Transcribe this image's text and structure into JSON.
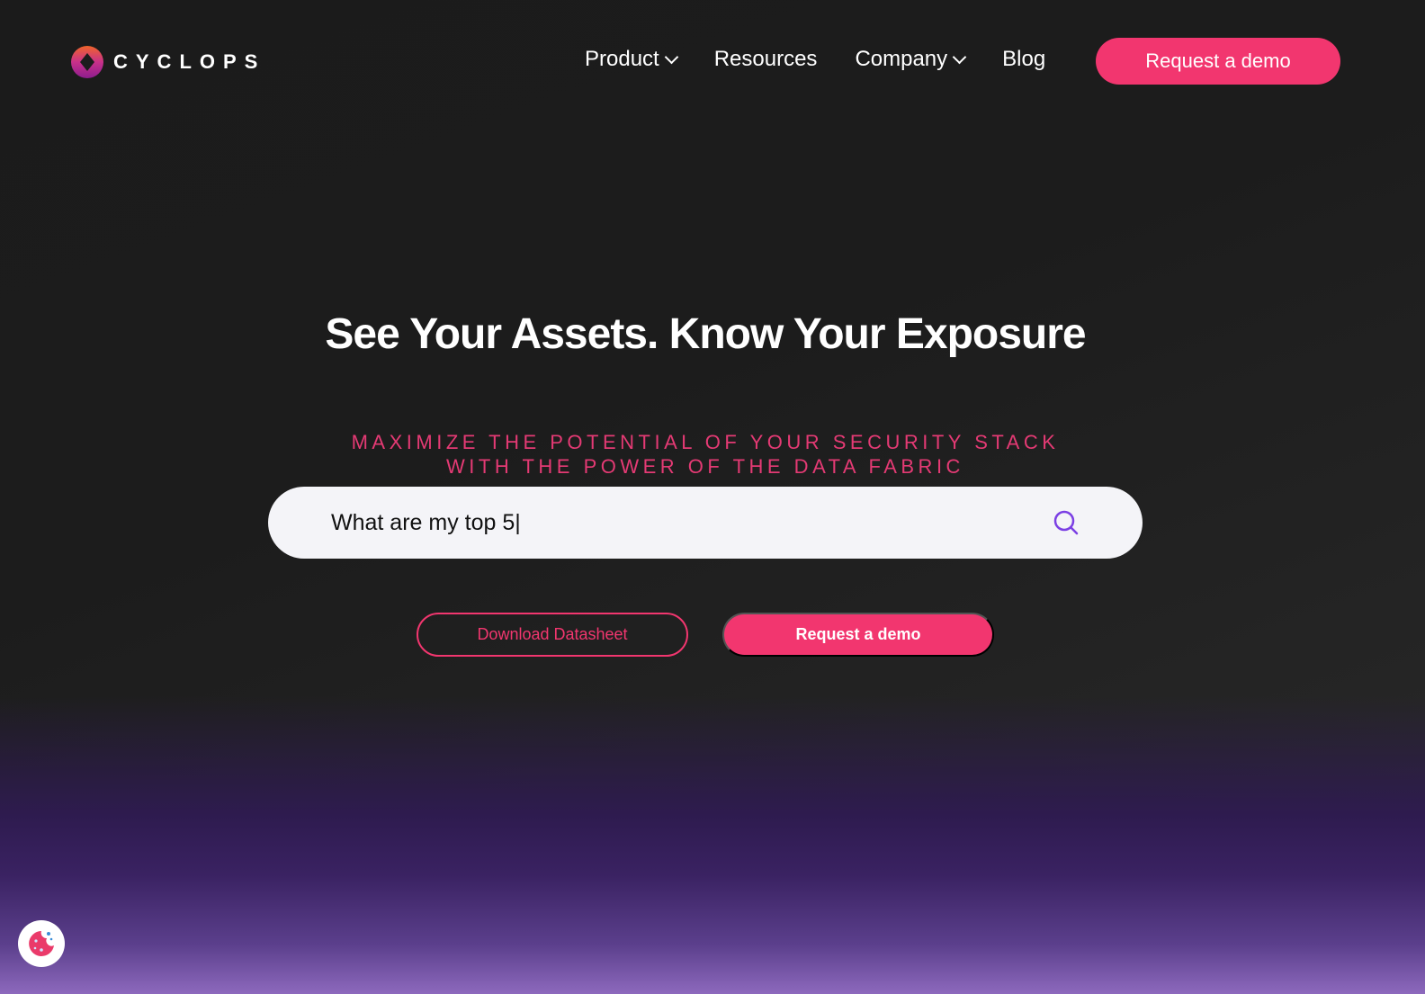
{
  "brand": {
    "name": "CYCLOPS"
  },
  "nav": {
    "items": [
      {
        "label": "Product",
        "dropdown": true
      },
      {
        "label": "Resources",
        "dropdown": false
      },
      {
        "label": "Company",
        "dropdown": true
      },
      {
        "label": "Blog",
        "dropdown": false
      }
    ],
    "cta": "Request a demo"
  },
  "hero": {
    "title": "See Your Assets. Know Your Exposure",
    "subtitle_line1": "MAXIMIZE THE POTENTIAL OF YOUR SECURITY STACK",
    "subtitle_line2": "WITH THE POWER OF THE DATA FABRIC",
    "search": {
      "value": "What are my top 5|",
      "icon": "search-icon"
    },
    "download_label": "Download Datasheet",
    "demo_label": "Request a demo"
  },
  "colors": {
    "accent": "#f2366f",
    "search_icon": "#7b3fe4"
  },
  "cookie": {
    "icon": "cookie-icon"
  }
}
